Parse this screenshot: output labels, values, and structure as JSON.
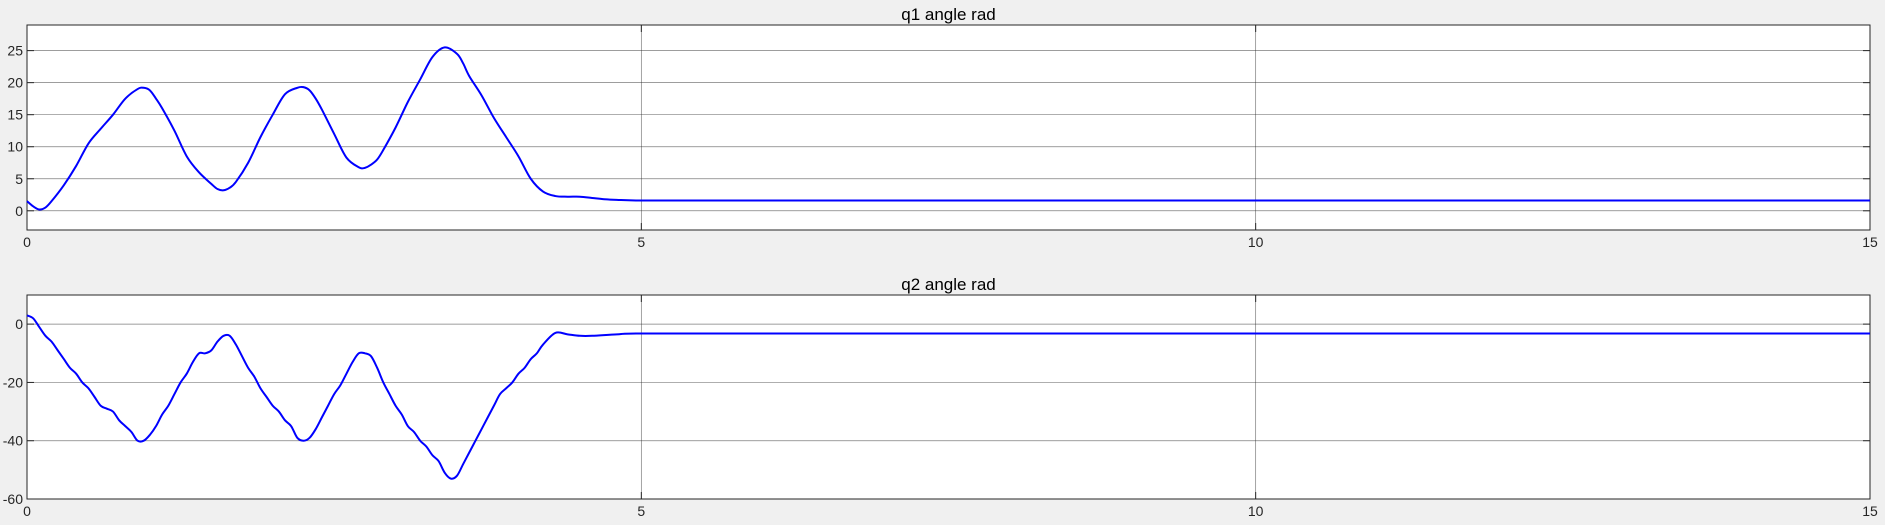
{
  "colors": {
    "background": "#f0f0f0",
    "axes_background": "#ffffff",
    "grid": "#262626",
    "axis_text": "#262626",
    "line": "#0000ff"
  },
  "chart_data": [
    {
      "type": "line",
      "title": "q1 angle rad",
      "xlabel": "",
      "ylabel": "",
      "xlim": [
        0,
        15
      ],
      "ylim": [
        -3,
        29
      ],
      "xticks": [
        0,
        5,
        10,
        15
      ],
      "yticks": [
        0,
        5,
        10,
        15,
        20,
        25
      ],
      "grid": true,
      "series": [
        {
          "color": "#0000ff",
          "x": [
            0,
            0.05,
            0.1,
            0.15,
            0.2,
            0.3,
            0.4,
            0.5,
            0.6,
            0.7,
            0.8,
            0.9,
            0.95,
            1.0,
            1.05,
            1.1,
            1.2,
            1.3,
            1.4,
            1.5,
            1.55,
            1.6,
            1.65,
            1.7,
            1.8,
            1.9,
            2.0,
            2.1,
            2.2,
            2.25,
            2.3,
            2.35,
            2.4,
            2.5,
            2.6,
            2.7,
            2.75,
            2.8,
            2.85,
            2.9,
            3.0,
            3.1,
            3.2,
            3.3,
            3.4,
            3.5,
            3.55,
            3.6,
            3.7,
            3.8,
            3.9,
            4.0,
            4.1,
            4.2,
            4.3,
            4.4,
            4.5,
            4.6,
            4.7,
            4.8,
            5.0,
            5.5,
            6,
            7,
            8,
            9,
            10,
            11,
            12,
            13,
            14,
            15
          ],
          "y": [
            1.5,
            0.7,
            0.2,
            0.5,
            1.5,
            4.0,
            7.0,
            10.5,
            12.8,
            15.0,
            17.5,
            19.0,
            19.2,
            18.8,
            17.5,
            16.0,
            12.5,
            8.5,
            6.0,
            4.2,
            3.4,
            3.2,
            3.6,
            4.5,
            7.5,
            11.5,
            15.0,
            18.2,
            19.2,
            19.3,
            18.8,
            17.5,
            15.8,
            12.0,
            8.3,
            6.8,
            6.7,
            7.2,
            8.0,
            9.5,
            13.0,
            17.0,
            20.5,
            24.0,
            25.5,
            24.5,
            23.0,
            21.0,
            18.0,
            14.5,
            11.5,
            8.5,
            5.0,
            3.0,
            2.3,
            2.2,
            2.2,
            2.0,
            1.8,
            1.7,
            1.6,
            1.6,
            1.6,
            1.6,
            1.6,
            1.6,
            1.6,
            1.6,
            1.6,
            1.6,
            1.6,
            1.6
          ]
        }
      ]
    },
    {
      "type": "line",
      "title": "q2 angle rad",
      "xlabel": "",
      "ylabel": "",
      "xlim": [
        0,
        15
      ],
      "ylim": [
        -60,
        10
      ],
      "xticks": [
        0,
        5,
        10,
        15
      ],
      "yticks": [
        -60,
        -40,
        -20,
        0
      ],
      "grid": true,
      "series": [
        {
          "color": "#0000ff",
          "x": [
            0,
            0.05,
            0.1,
            0.15,
            0.2,
            0.25,
            0.3,
            0.35,
            0.4,
            0.45,
            0.5,
            0.55,
            0.6,
            0.65,
            0.7,
            0.75,
            0.8,
            0.85,
            0.9,
            0.95,
            1.0,
            1.05,
            1.1,
            1.15,
            1.2,
            1.25,
            1.3,
            1.35,
            1.4,
            1.45,
            1.5,
            1.55,
            1.6,
            1.65,
            1.7,
            1.75,
            1.8,
            1.85,
            1.9,
            1.95,
            2.0,
            2.05,
            2.1,
            2.15,
            2.2,
            2.25,
            2.3,
            2.35,
            2.4,
            2.45,
            2.5,
            2.55,
            2.6,
            2.65,
            2.7,
            2.75,
            2.8,
            2.85,
            2.9,
            2.95,
            3.0,
            3.05,
            3.1,
            3.15,
            3.2,
            3.25,
            3.3,
            3.35,
            3.4,
            3.45,
            3.5,
            3.55,
            3.6,
            3.65,
            3.7,
            3.75,
            3.8,
            3.85,
            3.9,
            3.95,
            4.0,
            4.05,
            4.1,
            4.15,
            4.2,
            4.3,
            4.4,
            4.5,
            4.6,
            4.8,
            5.0,
            6,
            8,
            10,
            12,
            15
          ],
          "y": [
            3,
            2,
            -1,
            -4,
            -6,
            -9,
            -12,
            -15,
            -17,
            -20,
            -22,
            -25,
            -28,
            -29,
            -30,
            -33,
            -35,
            -37,
            -40,
            -40,
            -38,
            -35,
            -31,
            -28,
            -24,
            -20,
            -17,
            -13,
            -10,
            -10,
            -9,
            -6,
            -4,
            -4,
            -7,
            -11,
            -15,
            -18,
            -22,
            -25,
            -28,
            -30,
            -33,
            -35,
            -39,
            -40,
            -39,
            -36,
            -32,
            -28,
            -24,
            -21,
            -17,
            -13,
            -10,
            -10,
            -11,
            -15,
            -20,
            -24,
            -28,
            -31,
            -35,
            -37,
            -40,
            -42,
            -45,
            -47,
            -51,
            -53,
            -52,
            -48,
            -44,
            -40,
            -36,
            -32,
            -28,
            -24,
            -22,
            -20,
            -17,
            -15,
            -12,
            -10,
            -7,
            -3,
            -3.5,
            -4,
            -4,
            -3.5,
            -3.2,
            -3.2,
            -3.2,
            -3.2,
            -3.2,
            -3.2
          ]
        }
      ]
    }
  ]
}
